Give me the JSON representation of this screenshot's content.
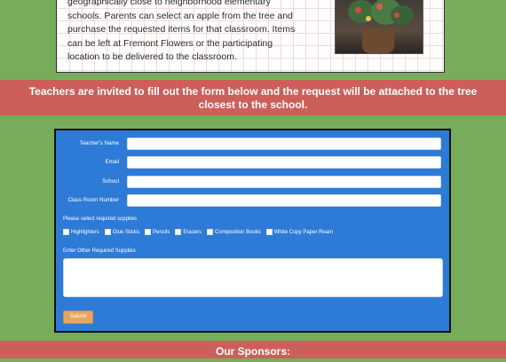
{
  "intro": {
    "lines": [
      "geographically close to neighborhood elementary",
      "schools. Parents can select an apple from the tree and",
      "purchase the requested items for that classroom. Items",
      "can be left at Fremont Flowers or the participating",
      "location to be delivered to the classroom."
    ]
  },
  "banner": {
    "line1": "Teachers are invited to fill out the form below and the request will be attached to the tree",
    "line2": "closest to the school."
  },
  "form": {
    "fields": [
      {
        "label": "Teacher's Name",
        "value": ""
      },
      {
        "label": "Email",
        "value": ""
      },
      {
        "label": "School",
        "value": ""
      },
      {
        "label": "Class Room Number",
        "value": ""
      }
    ],
    "supplies_label": "Please select required supplies",
    "supplies": [
      "Highlighters",
      "Glue Sticks",
      "Pencils",
      "Erasers",
      "Composition Books",
      "White Copy Paper Ream"
    ],
    "other_label": "Enter Other Required Supplies",
    "submit_label": "Submit"
  },
  "sponsors": {
    "title": "Our Sponsors:"
  },
  "colors": {
    "page_bg": "#77ad5a",
    "banner_bg": "#cd5f5a",
    "form_bg": "#2d7bd6",
    "submit_bg": "#e8a55c"
  }
}
